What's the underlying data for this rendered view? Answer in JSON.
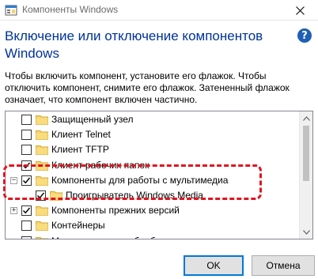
{
  "window": {
    "title": "Компоненты Windows",
    "close_label": "✕"
  },
  "heading": "Включение или отключение компонентов Windows",
  "help_label": "?",
  "description": "Чтобы включить компонент, установите его флажок. Чтобы отключить компонент, снимите его флажок. Затененный флажок означает, что компонент включен частично.",
  "tree": {
    "items": [
      {
        "label": "Защищенный узел",
        "checked": false,
        "expander": "",
        "level": 0
      },
      {
        "label": "Клиент Telnet",
        "checked": false,
        "expander": "",
        "level": 0
      },
      {
        "label": "Клиент TFTP",
        "checked": false,
        "expander": "",
        "level": 0
      },
      {
        "label": "Клиент рабочих папок",
        "checked": true,
        "expander": "",
        "level": 0
      },
      {
        "label": "Компоненты для работы с мультимедиа",
        "checked": true,
        "expander": "−",
        "level": 0
      },
      {
        "label": "Проигрыватель Windows Media",
        "checked": true,
        "expander": "",
        "level": 1
      },
      {
        "label": "Компоненты прежних версий",
        "checked": true,
        "expander": "+",
        "level": 0
      },
      {
        "label": "Контейнеры",
        "checked": false,
        "expander": "",
        "level": 0
      },
      {
        "label": "Мост для центра обработки данных",
        "checked": false,
        "expander": "",
        "level": 0
      }
    ]
  },
  "buttons": {
    "ok": "OK",
    "cancel": "Отмена"
  },
  "colors": {
    "heading": "#003399",
    "highlight": "#e0141e",
    "folder": "#f5d46b",
    "ok_border": "#0078d7"
  }
}
